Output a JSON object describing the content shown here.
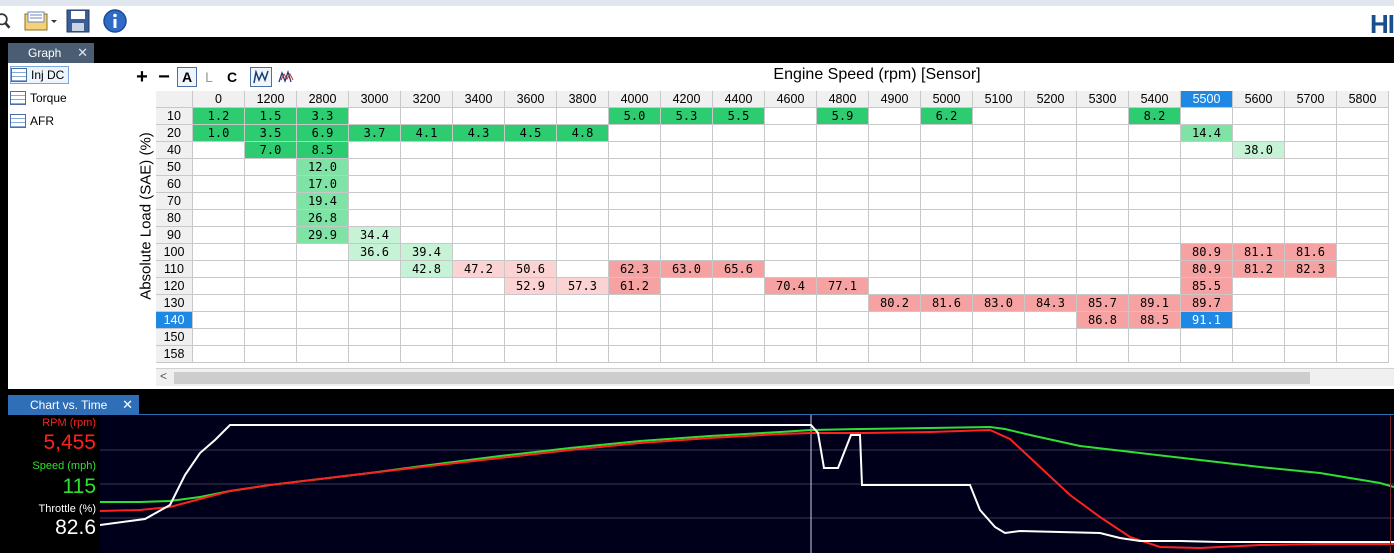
{
  "toolbar": {
    "icons": [
      "search-icon",
      "open-folder-icon",
      "save-icon",
      "info-icon"
    ],
    "brand": "HI"
  },
  "top_tab": {
    "label": "Graph",
    "close": "✕"
  },
  "tables_list": [
    {
      "label": "Inj DC",
      "selected": true
    },
    {
      "label": "Torque",
      "selected": false
    },
    {
      "label": "AFR",
      "selected": false
    }
  ],
  "controls": {
    "zoom_in": "+",
    "zoom_out": "−",
    "a": "A",
    "l": "L",
    "c": "C"
  },
  "table": {
    "x_title": "Engine Speed (rpm) [Sensor]",
    "y_title": "Absolute Load (SAE) (%)",
    "columns": [
      "0",
      "1200",
      "2800",
      "3000",
      "3200",
      "3400",
      "3600",
      "3800",
      "4000",
      "4200",
      "4400",
      "4600",
      "4800",
      "4900",
      "5000",
      "5100",
      "5200",
      "5300",
      "5400",
      "5500",
      "5600",
      "5700",
      "5800"
    ],
    "selected_column": "5500",
    "rows": [
      "10",
      "20",
      "40",
      "50",
      "60",
      "70",
      "80",
      "90",
      "100",
      "110",
      "120",
      "130",
      "140",
      "150",
      "158"
    ],
    "selected_row": "140",
    "cells": [
      [
        "1.2",
        "1.5",
        "3.3",
        "",
        "",
        "",
        "",
        "",
        "5.0",
        "5.3",
        "5.5",
        "",
        "5.9",
        "",
        "6.2",
        "",
        "",
        "",
        "8.2",
        "",
        "",
        "",
        ""
      ],
      [
        "1.0",
        "3.5",
        "6.9",
        "3.7",
        "4.1",
        "4.3",
        "4.5",
        "4.8",
        "",
        "",
        "",
        "",
        "",
        "",
        "",
        "",
        "",
        "",
        "",
        "14.4",
        "",
        "",
        ""
      ],
      [
        "",
        "7.0",
        "8.5",
        "",
        "",
        "",
        "",
        "",
        "",
        "",
        "",
        "",
        "",
        "",
        "",
        "",
        "",
        "",
        "",
        "",
        "38.0",
        "",
        ""
      ],
      [
        "",
        "",
        "12.0",
        "",
        "",
        "",
        "",
        "",
        "",
        "",
        "",
        "",
        "",
        "",
        "",
        "",
        "",
        "",
        "",
        "",
        "",
        "",
        ""
      ],
      [
        "",
        "",
        "17.0",
        "",
        "",
        "",
        "",
        "",
        "",
        "",
        "",
        "",
        "",
        "",
        "",
        "",
        "",
        "",
        "",
        "",
        "",
        "",
        ""
      ],
      [
        "",
        "",
        "19.4",
        "",
        "",
        "",
        "",
        "",
        "",
        "",
        "",
        "",
        "",
        "",
        "",
        "",
        "",
        "",
        "",
        "",
        "",
        "",
        ""
      ],
      [
        "",
        "",
        "26.8",
        "",
        "",
        "",
        "",
        "",
        "",
        "",
        "",
        "",
        "",
        "",
        "",
        "",
        "",
        "",
        "",
        "",
        "",
        "",
        ""
      ],
      [
        "",
        "",
        "29.9",
        "34.4",
        "",
        "",
        "",
        "",
        "",
        "",
        "",
        "",
        "",
        "",
        "",
        "",
        "",
        "",
        "",
        "",
        "",
        "",
        ""
      ],
      [
        "",
        "",
        "",
        "36.6",
        "39.4",
        "",
        "",
        "",
        "",
        "",
        "",
        "",
        "",
        "",
        "",
        "",
        "",
        "",
        "",
        "80.9",
        "81.1",
        "81.6",
        ""
      ],
      [
        "",
        "",
        "",
        "",
        "42.8",
        "47.2",
        "50.6",
        "",
        "62.3",
        "63.0",
        "65.6",
        "",
        "",
        "",
        "",
        "",
        "",
        "",
        "",
        "80.9",
        "81.2",
        "82.3",
        ""
      ],
      [
        "",
        "",
        "",
        "",
        "",
        "",
        "52.9",
        "57.3",
        "61.2",
        "",
        "",
        "70.4",
        "77.1",
        "",
        "",
        "",
        "",
        "",
        "",
        "85.5",
        "",
        "",
        ""
      ],
      [
        "",
        "",
        "",
        "",
        "",
        "",
        "",
        "",
        "",
        "",
        "",
        "",
        "",
        "80.2",
        "81.6",
        "83.0",
        "84.3",
        "85.7",
        "89.1",
        "89.7",
        "",
        "",
        ""
      ],
      [
        "",
        "",
        "",
        "",
        "",
        "",
        "",
        "",
        "",
        "",
        "",
        "",
        "",
        "",
        "",
        "",
        "",
        "86.8",
        "88.5",
        "91.1",
        "",
        "",
        ""
      ],
      [
        "",
        "",
        "",
        "",
        "",
        "",
        "",
        "",
        "",
        "",
        "",
        "",
        "",
        "",
        "",
        "",
        "",
        "",
        "",
        "",
        "",
        "",
        ""
      ],
      [
        "",
        "",
        "",
        "",
        "",
        "",
        "",
        "",
        "",
        "",
        "",
        "",
        "",
        "",
        "",
        "",
        "",
        "",
        "",
        "",
        "",
        "",
        ""
      ]
    ],
    "colors": {
      "green_strong": "#2ecc71",
      "green_mid": "#7ee3a4",
      "green_light": "#c6f2d6",
      "red_mid": "#f6a2a2",
      "red_light": "#fbd3d3",
      "selected": "#1e88e5"
    }
  },
  "bottom_tab": {
    "label": "Chart vs. Time",
    "close": "✕"
  },
  "chart_legend": [
    {
      "name": "RPM (rpm)",
      "value": "5,455",
      "color": "#ff2020"
    },
    {
      "name": "Speed (mph)",
      "value": "115",
      "color": "#30e030"
    },
    {
      "name": "Throttle (%)",
      "value": "82.6",
      "color": "#ffffff"
    }
  ]
}
